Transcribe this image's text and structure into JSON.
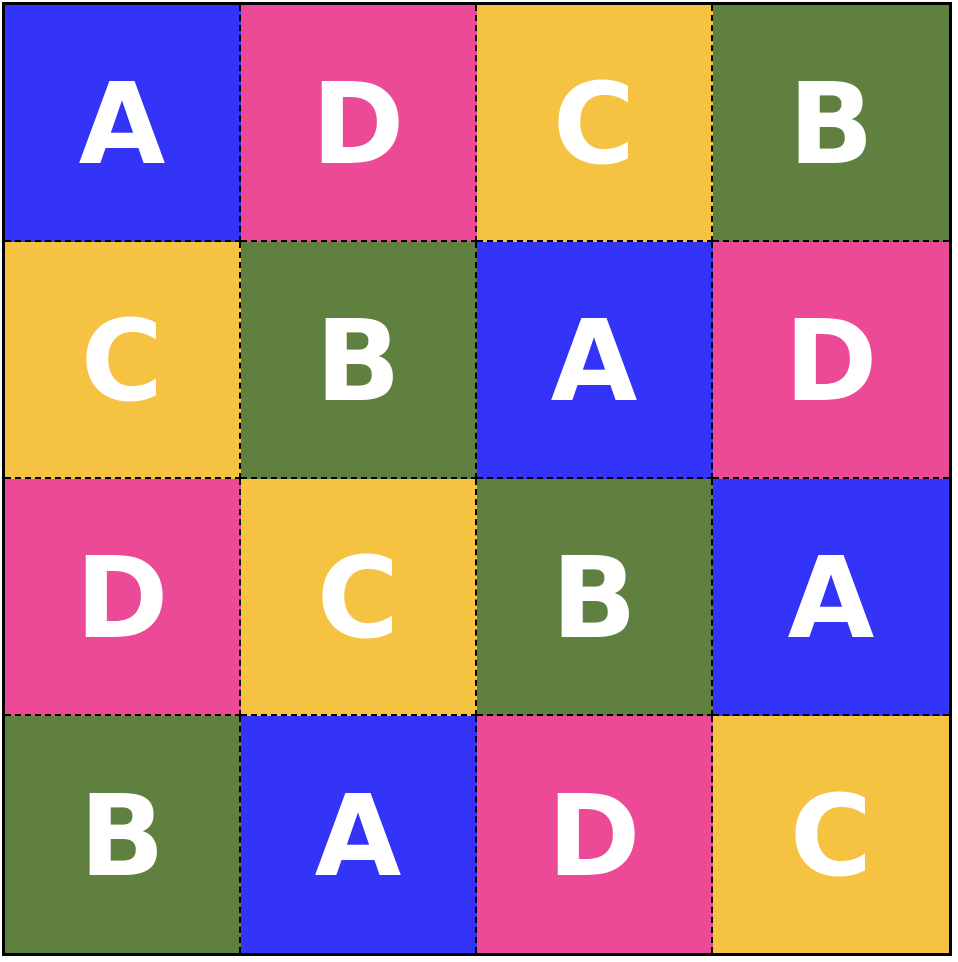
{
  "board": {
    "colors": {
      "A": "#3434F8",
      "B": "#608040",
      "C": "#F5C242",
      "D": "#EC4A96"
    },
    "rows": [
      [
        "A",
        "D",
        "C",
        "B"
      ],
      [
        "C",
        "B",
        "A",
        "D"
      ],
      [
        "D",
        "C",
        "B",
        "A"
      ],
      [
        "B",
        "A",
        "D",
        "C"
      ]
    ]
  }
}
